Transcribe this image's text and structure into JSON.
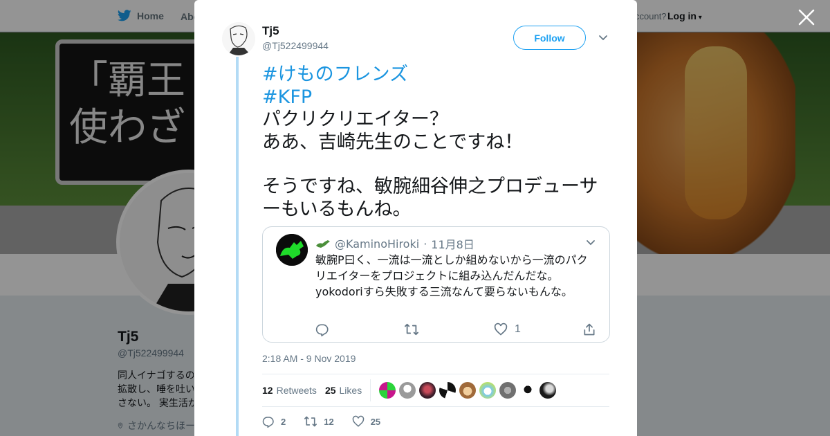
{
  "background": {
    "nav": {
      "home_label": "Home",
      "about_label": "Abo",
      "account_text": "ccount?",
      "login_label": "Log in"
    },
    "banner_text": [
      "「覇王",
      "使わざ"
    ],
    "profile": {
      "name": "Tj5",
      "handle": "@Tj522499944",
      "bio_lines": [
        "同人イナゴするの",
        "拡散し、唾を吐い",
        "さない。 実生活が"
      ],
      "location": "さかんなちほー"
    }
  },
  "tweet": {
    "author_name": "Tj5",
    "author_handle": "@Tj522499944",
    "follow_label": "Follow",
    "hashtags": [
      "#けものフレンズ",
      "#KFP"
    ],
    "lines": [
      "パクリクリエイター？",
      "ああ、吉崎先生のことですね！"
    ],
    "lines_after_gap": [
      "そうですね、敏腕細谷伸之プロデューサ",
      "ーもいるもんね。"
    ],
    "quoted": {
      "handle": "@KaminoHiroki",
      "separator": "·",
      "date": "11月8日",
      "text": "敏腕P曰く、一流は一流としか組めないから一流のパクリエイターをプロジェクトに組み込んだんだな。yokodoriすら失敗する三流なんて要らないもんな。",
      "like_count": "1"
    },
    "timestamp": "2:18 AM - 9 Nov 2019",
    "retweets_count": "12",
    "retweets_label": "Retweets",
    "likes_count": "25",
    "likes_label": "Likes",
    "action_counts": {
      "reply": "2",
      "retweet": "12",
      "like": "25"
    }
  },
  "colors": {
    "accent": "#1da1f2",
    "hashtag": "#1b95e0",
    "thread_line": "#b3dbf5",
    "muted": "#657786"
  },
  "icons": {
    "close": "close-icon",
    "twitter_bird": "twitter-bird-icon",
    "caret": "chevron-down-icon",
    "reply": "reply-icon",
    "retweet": "retweet-icon",
    "like": "heart-icon",
    "share": "share-icon",
    "location": "location-pin-icon"
  }
}
